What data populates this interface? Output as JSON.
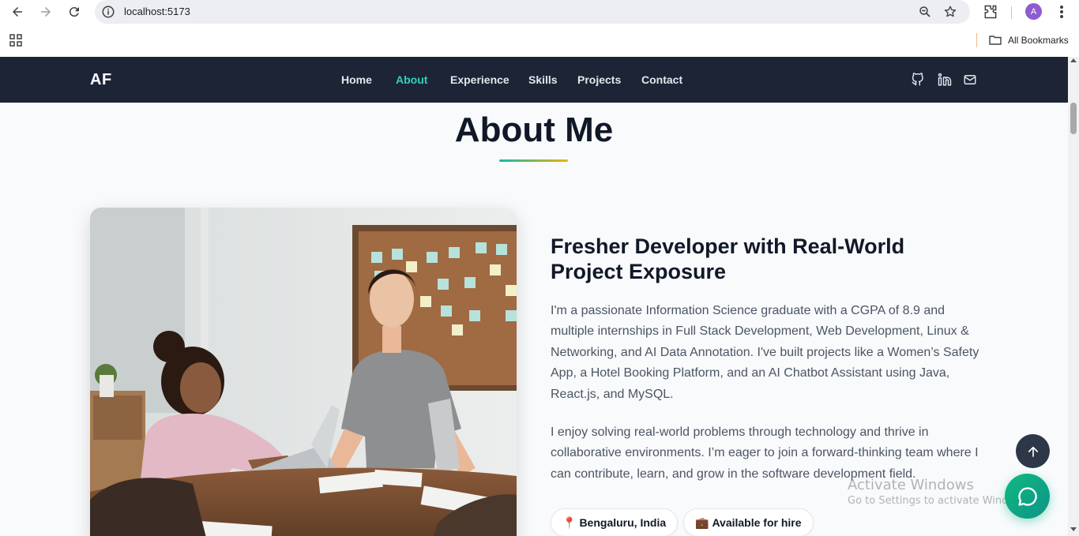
{
  "browser": {
    "url": "localhost:5173",
    "profile_initial": "A",
    "bookmarks_label": "All Bookmarks"
  },
  "nav": {
    "logo": "AF",
    "items": [
      {
        "label": "Home",
        "active": false
      },
      {
        "label": "About",
        "active": true
      },
      {
        "label": "Experience",
        "active": false
      },
      {
        "label": "Skills",
        "active": false
      },
      {
        "label": "Projects",
        "active": false
      },
      {
        "label": "Contact",
        "active": false
      }
    ]
  },
  "about": {
    "title": "About Me",
    "heading": "Fresher Developer with Real-World Project Exposure",
    "paragraph1": "I'm a passionate Information Science graduate with a CGPA of 8.9 and multiple internships in Full Stack Development, Web Development, Linux & Networking, and AI Data Annotation. I've built projects like a Women’s Safety App, a Hotel Booking Platform, and an AI Chatbot Assistant using Java, React.js, and MySQL.",
    "paragraph2": "I enjoy solving real-world problems through technology and thrive in collaborative environments. I’m eager to join a forward-thinking team where I can contribute, learn, and grow in the software development field.",
    "tags": [
      {
        "icon": "📍",
        "label": "Bengaluru, India"
      },
      {
        "icon": "💼",
        "label": "Available for hire"
      }
    ]
  },
  "watermark": {
    "line1": "Activate Windows",
    "line2": "Go to Settings to activate Windows."
  },
  "colors": {
    "nav_bg": "#1c2436",
    "accent": "#2dd4bf",
    "chat_button": "#10b981"
  }
}
